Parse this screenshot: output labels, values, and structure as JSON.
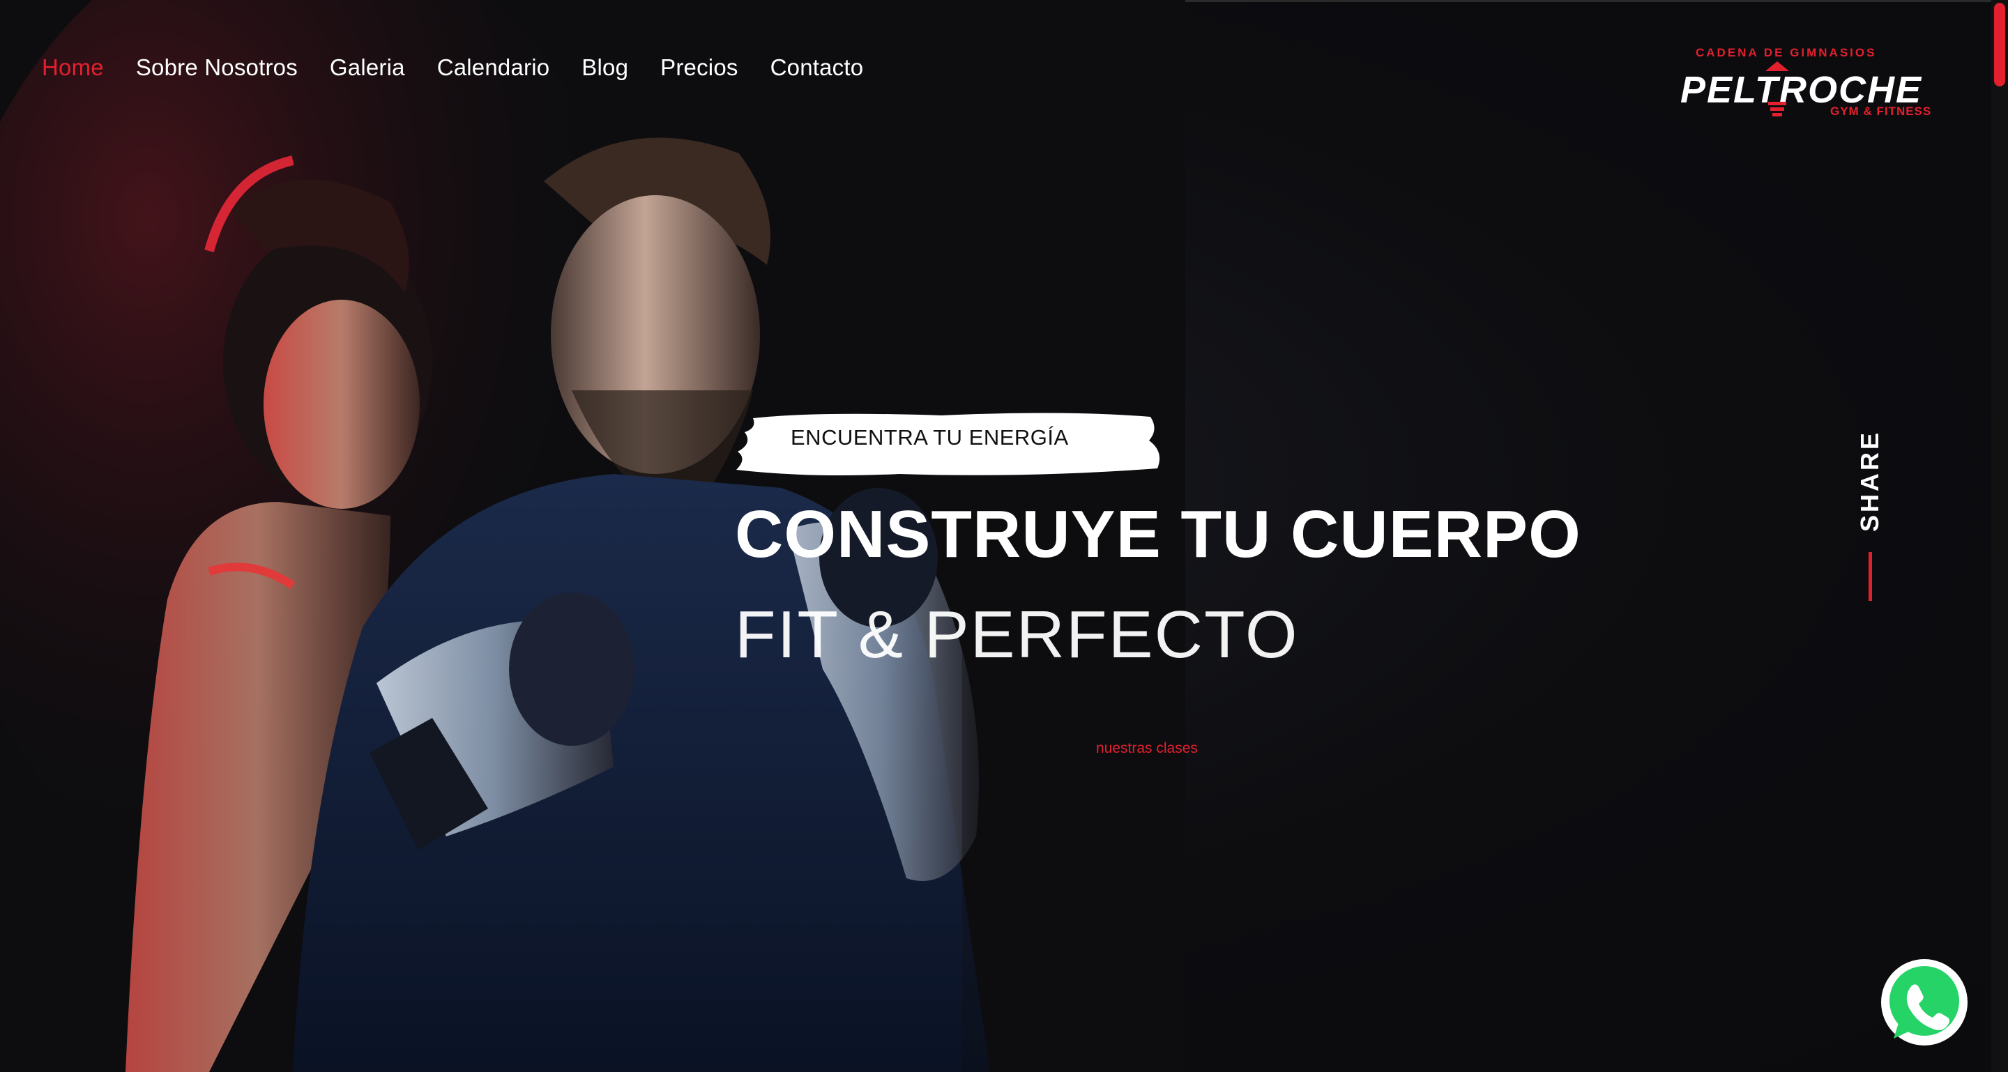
{
  "nav": {
    "items": [
      {
        "label": "Home",
        "active": true
      },
      {
        "label": "Sobre Nosotros"
      },
      {
        "label": "Galeria"
      },
      {
        "label": "Calendario"
      },
      {
        "label": "Blog"
      },
      {
        "label": "Precios"
      },
      {
        "label": "Contacto"
      }
    ]
  },
  "logo": {
    "top_text": "CADENA DE GIMNASIOS",
    "main_text": "PELTROCHE",
    "sub_text": "GYM & FITNESS"
  },
  "hero": {
    "tagline": "ENCUENTRA TU ENERGÍA",
    "title_line1": "CONSTRUYE TU CUERPO",
    "title_line2": "FIT & PERFECTO",
    "cta_label": "nuestras clases"
  },
  "share": {
    "label": "SHARE"
  },
  "icons": {
    "whatsapp": "whatsapp-icon"
  },
  "colors": {
    "accent": "#e3202e",
    "background": "#0d0d10",
    "text": "#ffffff",
    "whatsapp": "#25d366"
  }
}
